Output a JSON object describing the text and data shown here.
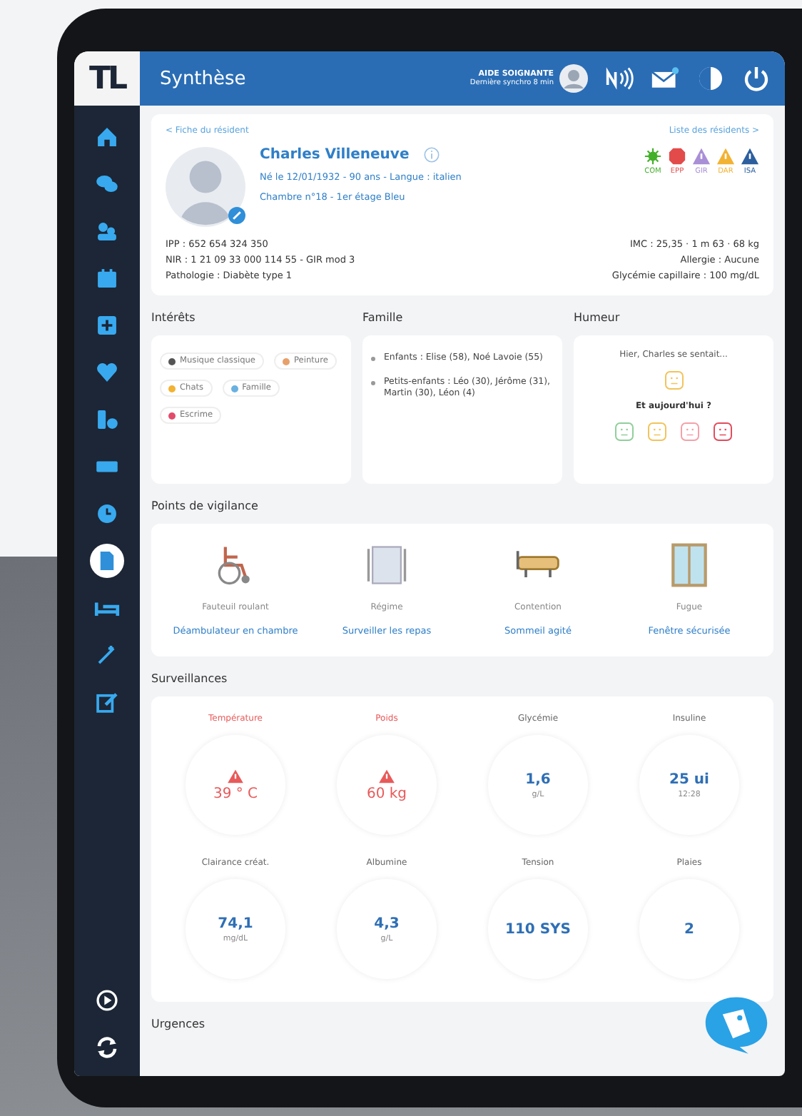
{
  "sidebar": {
    "logo": "TL",
    "items": [
      {
        "selected": false
      },
      {
        "selected": false
      },
      {
        "selected": false
      },
      {
        "selected": false
      },
      {
        "selected": false
      },
      {
        "selected": false
      },
      {
        "selected": false
      },
      {
        "selected": false
      },
      {
        "selected": false
      },
      {
        "selected": true
      },
      {
        "selected": false
      },
      {
        "selected": false
      },
      {
        "selected": false
      }
    ],
    "bottom_items": [
      {
        "selected": false
      },
      {
        "selected": false
      }
    ]
  },
  "header": {
    "title": "Synthèse",
    "user_name": "AIDE SOIGNANTE",
    "user_status": "Dernière synchro 8 min"
  },
  "patient": {
    "back_link": "< Fiche du résident",
    "next_link": "Liste des résidents >",
    "name": "Charles Villeneuve",
    "line_1": "Né le 12/01/1932 - 90 ans - Langue : italien",
    "line_2": "Chambre n°18 - 1er étage Bleu",
    "badges": [
      {
        "label": "COM",
        "color": "#43b02a"
      },
      {
        "label": "EPP",
        "color": "#e34b4b"
      },
      {
        "label": "GIR",
        "color": "#a98fd6"
      },
      {
        "label": "DAR",
        "color": "#f2b233"
      },
      {
        "label": "ISA",
        "color": "#2d5f9e"
      }
    ],
    "info_left": [
      "IPP : 652 654 324 350",
      "NIR : 1 21 09 33 000 114 55 - GIR mod 3",
      "Pathologie : Diabète type 1"
    ],
    "info_right": [
      "IMC : 25,35 · 1 m 63 · 68 kg",
      "Allergie : Aucune",
      "Glycémie capillaire : 100 mg/dL"
    ]
  },
  "interests": {
    "title": "Intérêts",
    "tags": [
      {
        "label": "Musique classique",
        "color": "#555555"
      },
      {
        "label": "Peinture",
        "color": "#e8a06a"
      },
      {
        "label": "Chats",
        "color": "#f2b233"
      },
      {
        "label": "Famille",
        "color": "#6ab0e0"
      },
      {
        "label": "Escrime",
        "color": "#e34b6b"
      }
    ]
  },
  "family": {
    "title": "Famille",
    "items": [
      "Enfants : Elise (58), Noé Lavoie (55)",
      "Petits-enfants : Léo (30), Jérôme (31), Martin (30), Léon (4)"
    ]
  },
  "mood": {
    "title": "Humeur",
    "yesterday": "Hier, Charles se sentait...",
    "yesterday_face": {
      "color": "#f2c35a"
    },
    "question": "Et aujourd'hui ?",
    "faces": [
      {
        "color": "#8fcf9a",
        "selected": false
      },
      {
        "color": "#f2c35a",
        "selected": false
      },
      {
        "color": "#f3a0a8",
        "selected": false
      },
      {
        "color": "#e34b5b",
        "selected": false
      }
    ]
  },
  "vigilance": {
    "title": "Points de vigilance",
    "items": [
      {
        "label": "Fauteuil roulant",
        "value": "Déambulateur en chambre"
      },
      {
        "label": "Régime",
        "value": "Surveiller les repas"
      },
      {
        "label": "Contention",
        "value": "Sommeil agité"
      },
      {
        "label": "Fugue",
        "value": "Fenêtre sécurisée"
      }
    ]
  },
  "surveillance": {
    "title": "Surveillances",
    "items": [
      {
        "label": "Température",
        "value": "39 ° C",
        "alert": true
      },
      {
        "label": "Poids",
        "value": "60 kg",
        "alert": true
      },
      {
        "label": "Glycémie",
        "value": "1,6",
        "unit": "g/L",
        "alert": false
      },
      {
        "label": "Insuline",
        "value": "25 ui",
        "unit": "12:28",
        "alert": false
      },
      {
        "label": "Clairance créat.",
        "value": "74,1",
        "unit": "mg/dL",
        "alert": false
      },
      {
        "label": "Albumine",
        "value": "4,3",
        "unit": "g/L",
        "alert": false
      },
      {
        "label": "Tension",
        "value": "110 SYS",
        "alert": false
      },
      {
        "label": "Plaies",
        "value": "2",
        "alert": false
      }
    ]
  },
  "next_section": "Urgences"
}
